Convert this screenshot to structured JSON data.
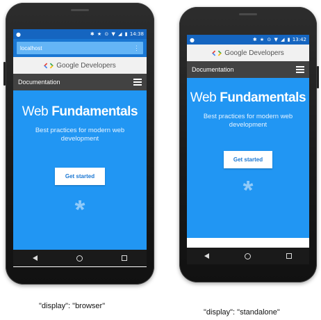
{
  "colors": {
    "brand_blue": "#2196f3",
    "status_blue": "#1565c0",
    "toolbar_blue": "#1976d2",
    "doc_bar": "#424242",
    "google_blue": "#4285f4",
    "google_red": "#ea4335",
    "google_yellow": "#fbbc05",
    "google_green": "#34a853"
  },
  "left_phone": {
    "status_time": "14:38",
    "status_icons": "✱ ★ ⊙ ▼ ◢ ▮",
    "url_text": "localhost",
    "site_name": "Google Developers",
    "nav_label": "Documentation",
    "hero_title_light": "Web ",
    "hero_title_bold": "Fundamentals",
    "hero_subtitle": "Best practices for modern web development",
    "cta_label": "Get started",
    "asterisk": "*",
    "caption": "\"display\": \"browser\""
  },
  "right_phone": {
    "status_time": "13:42",
    "status_icons": "✱ ★ ⊙ ▼ ◢ ▮",
    "site_name": "Google Developers",
    "nav_label": "Documentation",
    "hero_title_light": "Web ",
    "hero_title_bold": "Fundamentals",
    "hero_subtitle": "Best practices for modern web development",
    "cta_label": "Get started",
    "asterisk": "*",
    "caption": "\"display\": \"standalone\""
  },
  "icons": {
    "hamburger": "menu-icon",
    "back": "back-triangle-icon",
    "home": "home-circle-icon",
    "recent": "recent-apps-square-icon",
    "overflow": "overflow-dots-icon"
  }
}
